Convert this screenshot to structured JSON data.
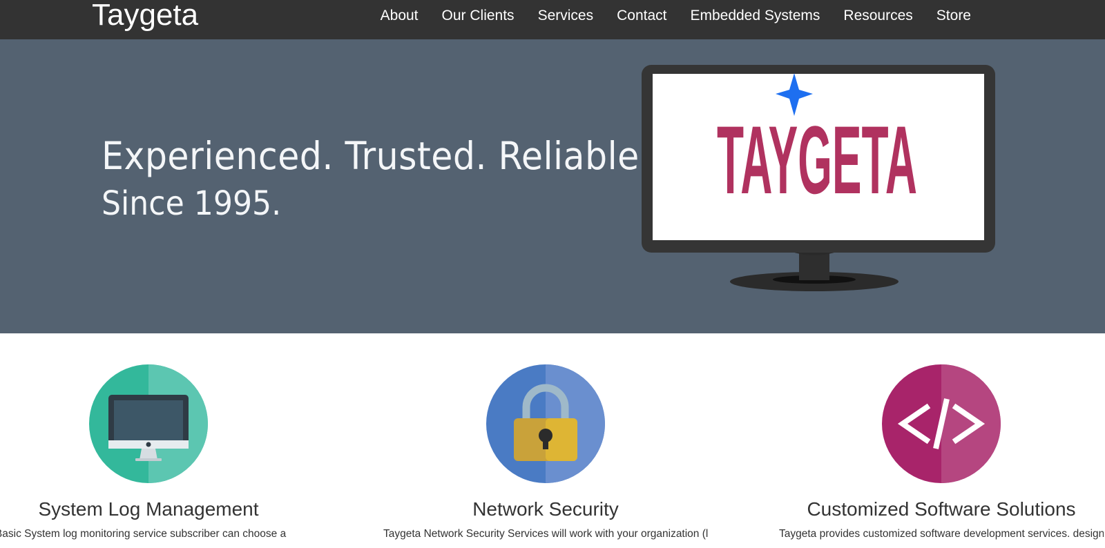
{
  "navbar": {
    "brand": "Taygeta",
    "links": [
      "About",
      "Our Clients",
      "Services",
      "Contact",
      "Embedded Systems",
      "Resources",
      "Store"
    ]
  },
  "hero": {
    "line1": "Experienced. Trusted. Reliable.",
    "line2": "Since 1995.",
    "logo_text": "TAYGETA",
    "logo_color": "#b0325f",
    "star_color": "#1e6ff0",
    "background": "#546271"
  },
  "features": [
    {
      "icon": "monitor-icon",
      "title": "System Log Management",
      "text": "a Basic System log monitoring service subscriber can choose a",
      "color": "#33b89b"
    },
    {
      "icon": "padlock-icon",
      "title": "Network Security",
      "text": "Taygeta Network Security Services will work with your organization (large or",
      "color": "#4a7bc4"
    },
    {
      "icon": "code-icon",
      "title": "Customized Software Solutions",
      "text": "Taygeta provides customized software development services. designs",
      "color": "#a8246a"
    }
  ]
}
